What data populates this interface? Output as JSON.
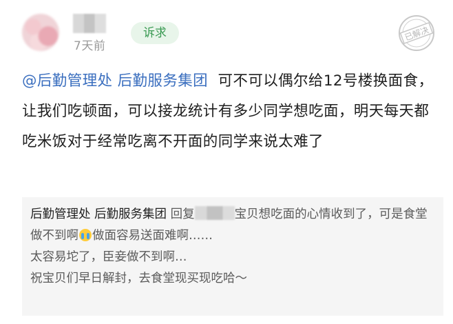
{
  "post": {
    "time": "7天前",
    "tag": "诉求",
    "status_stamp": "已解决",
    "content": {
      "mentions": "@后勤管理处 后勤服务集团",
      "text": "可不可以偶尔给12号楼换面食，让我们吃顿面，可以接龙统计有多少同学想吃面，明天每天都吃米饭对于经常吃离不开面的同学来说太难了"
    }
  },
  "reply": {
    "author": "后勤管理处 后勤服务集团",
    "verb": "回复",
    "text_part1": "宝贝想吃面的心情收到了，可是食堂做不到啊",
    "emoji": "crying-face-icon",
    "text_part2": "做面容易送面难啊……",
    "line3": "太容易坨了，臣妾做不到啊…",
    "line4": "祝宝贝们早日解封，去食堂现买现吃哈～"
  },
  "colors": {
    "mention": "#3b6fbf",
    "tag_text": "#3a9a53",
    "tag_bg": "#e8f5ea",
    "reply_bg": "#f5f5f5"
  }
}
